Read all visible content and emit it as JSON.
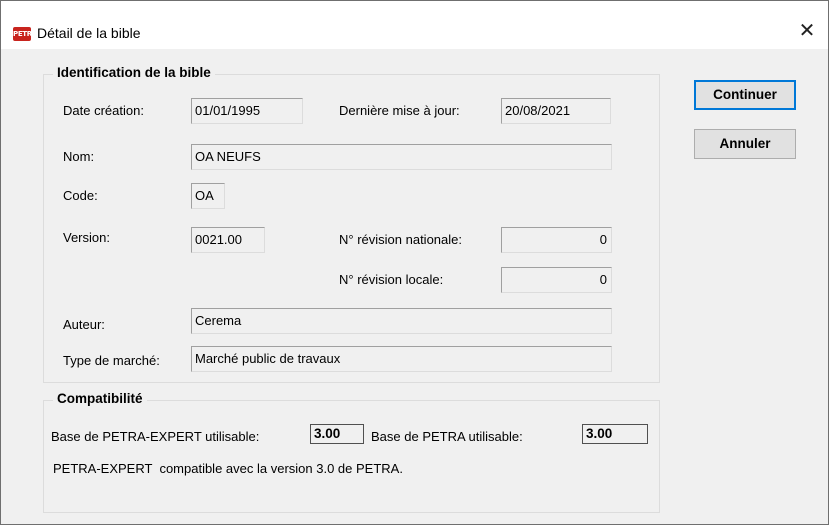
{
  "window": {
    "title": "Détail de la bible",
    "icon": "petra-app-icon",
    "icon_text": "PETRA",
    "close_symbol": "✕"
  },
  "identification": {
    "legend": "Identification de la bible",
    "date_creation_label": "Date création:",
    "date_creation_value": "01/01/1995",
    "derniere_maj_label": "Dernière mise à jour:",
    "derniere_maj_value": "20/08/2021",
    "nom_label": "Nom:",
    "nom_value": "OA NEUFS",
    "code_label": "Code:",
    "code_value": "OA",
    "version_label": "Version:",
    "version_value": "0021.00",
    "revision_nationale_label": "N° révision nationale:",
    "revision_nationale_value": "0",
    "revision_locale_label": "N° révision locale:",
    "revision_locale_value": "0",
    "auteur_label": "Auteur:",
    "auteur_value": "Cerema",
    "type_marche_label": "Type de marché:",
    "type_marche_value": "Marché public de travaux"
  },
  "compatibilite": {
    "legend": "Compatibilité",
    "base_expert_label": "Base de PETRA-EXPERT utilisable:",
    "base_expert_value": "3.00",
    "base_petra_label": "Base de PETRA utilisable:",
    "base_petra_value": "3.00",
    "message": "PETRA-EXPERT  compatible avec la version 3.0 de PETRA."
  },
  "buttons": {
    "continuer": "Continuer",
    "annuler": "Annuler"
  },
  "colors": {
    "accent": "#0078d7",
    "dialog_bg": "#f0f0f0",
    "icon_red": "#c8241e"
  }
}
